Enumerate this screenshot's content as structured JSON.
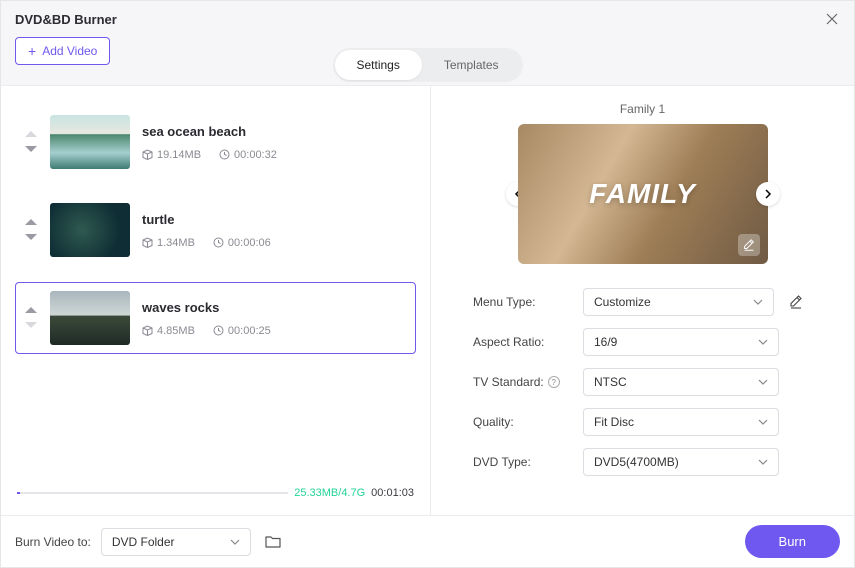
{
  "window": {
    "title": "DVD&BD Burner"
  },
  "toolbar": {
    "add_video": "Add Video"
  },
  "tabs": {
    "settings": "Settings",
    "templates": "Templates",
    "active": "settings"
  },
  "videos": [
    {
      "title": "sea ocean beach",
      "size": "19.14MB",
      "duration": "00:00:32",
      "selected": false,
      "thumb": "ocean"
    },
    {
      "title": "turtle",
      "size": "1.34MB",
      "duration": "00:00:06",
      "selected": false,
      "thumb": "turtle"
    },
    {
      "title": "waves rocks",
      "size": "4.85MB",
      "duration": "00:00:25",
      "selected": true,
      "thumb": "rocks"
    }
  ],
  "footer": {
    "size_ratio": "25.33MB/4.7G",
    "total_duration": "00:01:03"
  },
  "preview": {
    "title": "Family 1",
    "overlay_text": "FAMILY"
  },
  "form": {
    "labels": {
      "menu_type": "Menu Type:",
      "aspect_ratio": "Aspect Ratio:",
      "tv_standard": "TV Standard:",
      "quality": "Quality:",
      "dvd_type": "DVD Type:"
    },
    "values": {
      "menu_type": "Customize",
      "aspect_ratio": "16/9",
      "tv_standard": "NTSC",
      "quality": "Fit Disc",
      "dvd_type": "DVD5(4700MB)"
    }
  },
  "bottom": {
    "label": "Burn Video to:",
    "target": "DVD Folder",
    "burn": "Burn"
  }
}
